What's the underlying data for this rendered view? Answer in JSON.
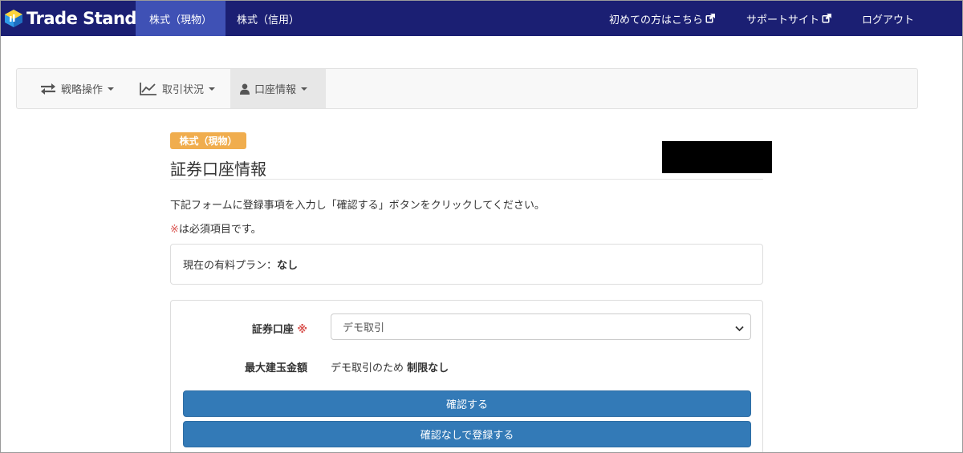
{
  "app": {
    "logo_text": "Trade Stand"
  },
  "topnav": {
    "tabs": [
      {
        "label": "株式（現物）",
        "active": true
      },
      {
        "label": "株式（信用）",
        "active": false
      }
    ],
    "right_links": [
      {
        "label": "初めての方はこちら",
        "icon": "external-link-icon"
      },
      {
        "label": "サポートサイト",
        "icon": "external-link-icon"
      },
      {
        "label": "ログアウト"
      }
    ]
  },
  "subnav": {
    "items": [
      {
        "label": "戦略操作",
        "icon": "exchange-arrows-icon"
      },
      {
        "label": "取引状況",
        "icon": "line-chart-icon"
      },
      {
        "label": "口座情報",
        "icon": "user-icon",
        "active": true
      }
    ]
  },
  "page": {
    "badge": "株式（現物）",
    "title": "証券口座情報",
    "instruction": "下記フォームに登録事項を入力し「確認する」ボタンをクリックしてください。",
    "required_mark": "※",
    "required_note": "は必須項目です。",
    "plan_label": "現在の有料プラン：",
    "plan_value": "なし"
  },
  "form": {
    "account_label": "証券口座",
    "account_required": "※",
    "account_selected": "デモ取引",
    "limit_label": "最大建玉金額",
    "limit_prefix": "デモ取引のため ",
    "limit_value": "制限なし",
    "confirm_button": "確認する",
    "register_button": "確認なしで登録する"
  },
  "colors": {
    "topbar": "#1b1f73",
    "active_tab": "#3f51b5",
    "badge": "#f0ad4e",
    "primary_button": "#337ab7",
    "required": "#d9534f"
  }
}
